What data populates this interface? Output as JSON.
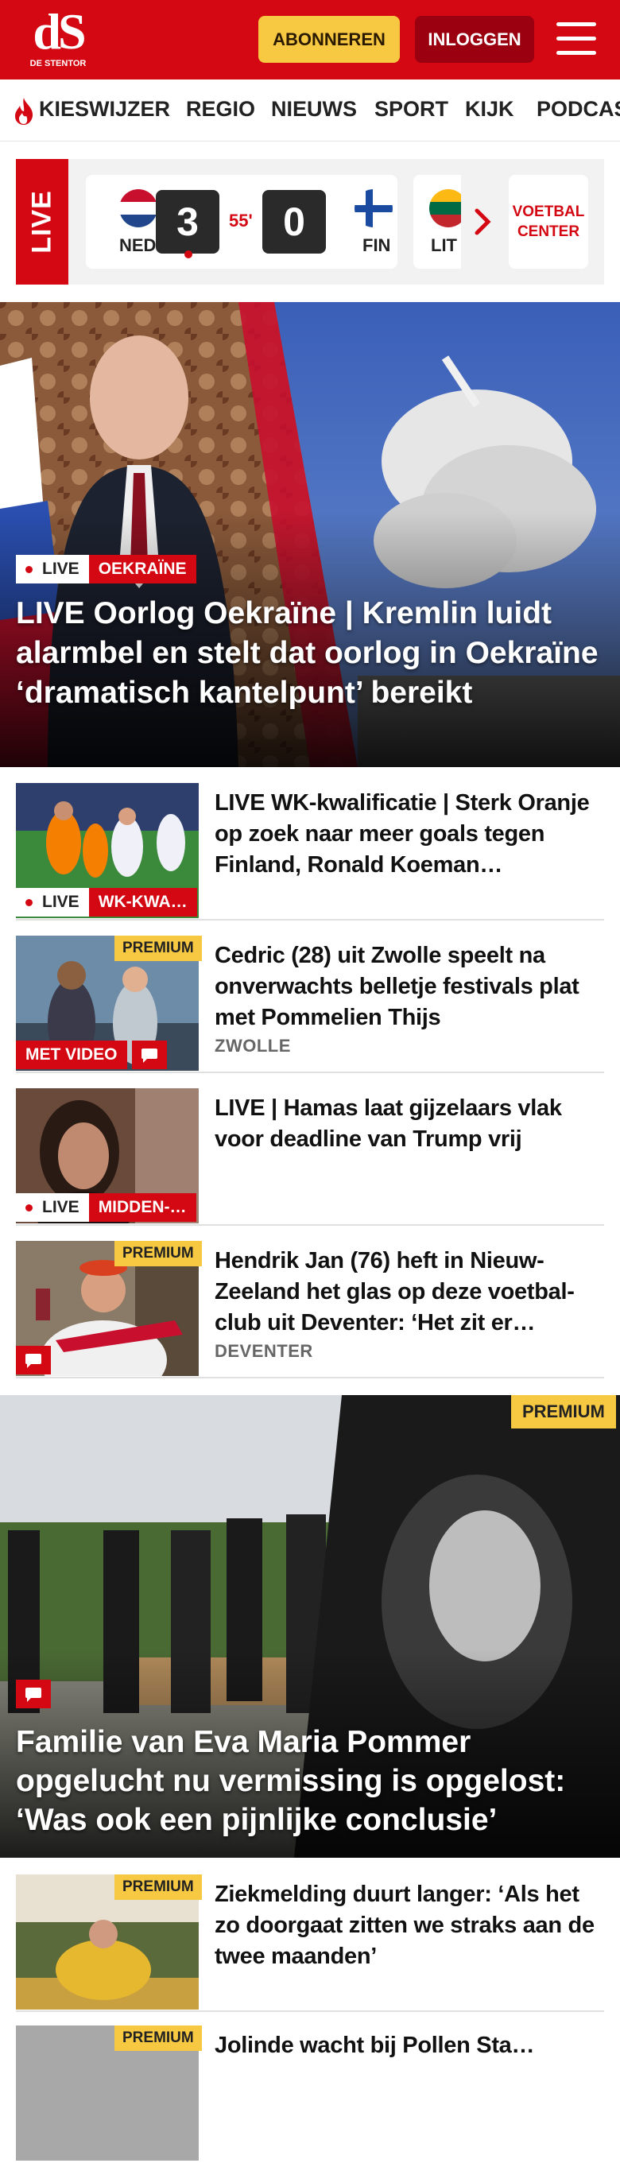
{
  "header": {
    "logo_text": "dS",
    "logo_subtitle": "DE STENTOR",
    "subscribe_label": "ABONNEREN",
    "login_label": "INLOGGEN",
    "brand_color": "#d40812"
  },
  "nav": {
    "items": [
      {
        "label": "KIESWIJZER",
        "icon": "flame-icon"
      },
      {
        "label": "REGIO"
      },
      {
        "label": "NIEUWS"
      },
      {
        "label": "SPORT"
      },
      {
        "label": "KIJK"
      },
      {
        "label": "PODCAS"
      }
    ]
  },
  "scoreboard": {
    "live_label": "LIVE",
    "home_code": "NED",
    "home_score": "3",
    "minute": "55'",
    "away_score": "0",
    "away_code": "FIN",
    "next_code": "LIT",
    "center_label_1": "VOETBAL",
    "center_label_2": "CENTER"
  },
  "hero": {
    "live_badge": "LIVE",
    "section_badge": "OEKRAÏNE",
    "title": "LIVE Oorlog Oekraïne | Kremlin luidt alarmbel en stelt dat oorlog in Oekraïne ‘dramatisch kantelpunt’ bereikt"
  },
  "articles": [
    {
      "title": "LIVE WK-kwalificatie | Sterk Oranje op zoek naar meer goals tegen Finland, Ronald Koeman…",
      "live_badge": "LIVE",
      "section_badge": "WK-KWA…"
    },
    {
      "title": "Cedric (28) uit Zwolle speelt na onverwachts belletje festivals plat met Pommelien Thijs",
      "premium": "PREMIUM",
      "video_label": "MET VIDEO",
      "location": "ZWOLLE"
    },
    {
      "title": "LIVE | Hamas laat gijzelaars vlak voor deadline van Trump vrij",
      "live_badge": "LIVE",
      "section_badge": "MIDDEN-…"
    },
    {
      "title": "Hendrik Jan (76) heft in Nieuw-Zeeland het glas op deze voetbal-club uit Deventer: ‘Het zit er…",
      "premium": "PREMIUM",
      "location": "DEVENTER"
    }
  ],
  "feature": {
    "premium": "PREMIUM",
    "title": "Familie van Eva Maria Pommer opgelucht nu vermissing is opgelost: ‘Was ook een pijnlijke conclusie’"
  },
  "article_bottom": {
    "premium": "PREMIUM",
    "title": "Ziekmelding duurt langer: ‘Als het zo doorgaat zitten we straks aan de twee maanden’"
  },
  "article_peek": {
    "premium": "PREMIUM",
    "title": "Jolinde wacht bij Pollen Sta…"
  }
}
